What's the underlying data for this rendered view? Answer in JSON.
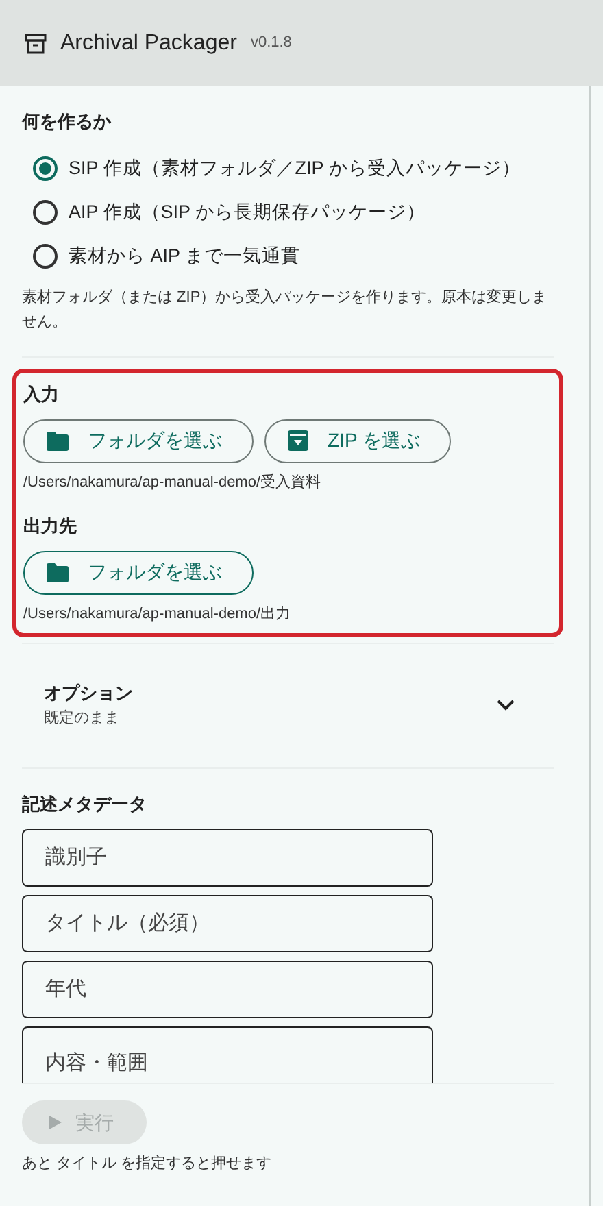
{
  "app": {
    "title": "Archival Packager",
    "version": "v0.1.8"
  },
  "mode": {
    "heading": "何を作るか",
    "options": [
      {
        "label": "SIP 作成（素材フォルダ／ZIP から受入パッケージ）",
        "selected": true
      },
      {
        "label": "AIP 作成（SIP から長期保存パッケージ）",
        "selected": false
      },
      {
        "label": "素材から AIP まで一気通貫",
        "selected": false
      }
    ],
    "description": "素材フォルダ（または ZIP）から受入パッケージを作ります。原本は変更しません。"
  },
  "paths": {
    "highlighted": true,
    "groups": [
      {
        "heading": "入力",
        "buttons": [
          {
            "kind": "folder",
            "label": "フォルダを選ぶ"
          },
          {
            "kind": "zip",
            "label": "ZIP を選ぶ"
          }
        ],
        "path": "/Users/nakamura/ap-manual-demo/受入資料"
      },
      {
        "heading": "出力先",
        "buttons": [
          {
            "kind": "folder",
            "label": "フォルダを選ぶ"
          }
        ],
        "path": "/Users/nakamura/ap-manual-demo/出力"
      }
    ]
  },
  "options_panel": {
    "title": "オプション",
    "subtitle": "既定のまま",
    "expanded": false
  },
  "metadata": {
    "heading": "記述メタデータ",
    "fields": [
      {
        "kind": "input",
        "placeholder": "識別子"
      },
      {
        "kind": "input",
        "placeholder": "タイトル（必須）"
      },
      {
        "kind": "input",
        "placeholder": "年代"
      },
      {
        "kind": "textarea",
        "placeholder": "内容・範囲"
      }
    ]
  },
  "run": {
    "label": "実行",
    "disabled": true,
    "hint": "あと タイトル を指定すると押せます"
  }
}
